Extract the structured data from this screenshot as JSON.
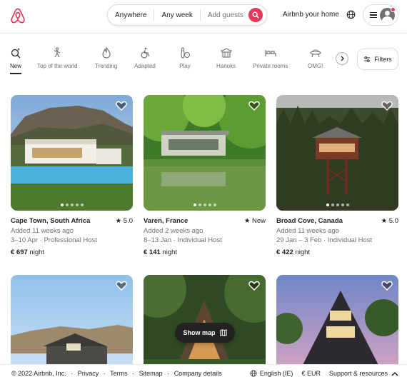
{
  "header": {
    "search": {
      "where": "Anywhere",
      "when": "Any week",
      "who": "Add guests"
    },
    "host_link": "Airbnb your home"
  },
  "categories": [
    {
      "label": "New",
      "icon": "new-sparkle-icon",
      "active": true
    },
    {
      "label": "Top of the world",
      "icon": "mountain-climber-icon"
    },
    {
      "label": "Trending",
      "icon": "flame-icon"
    },
    {
      "label": "Adapted",
      "icon": "wheelchair-icon"
    },
    {
      "label": "Play",
      "icon": "bowling-icon"
    },
    {
      "label": "Hanoks",
      "icon": "hanok-house-icon"
    },
    {
      "label": "Private rooms",
      "icon": "bed-icon"
    },
    {
      "label": "OMG!",
      "icon": "ufo-house-icon"
    }
  ],
  "filters_label": "Filters",
  "listings": [
    {
      "title": "Cape Town, South Africa",
      "rating": "5.0",
      "added": "Added 11 weeks ago",
      "dates_host": "3–10 Apr · Professional Host",
      "price": "€ 697",
      "price_unit": " night"
    },
    {
      "title": "Varen, France",
      "rating": "New",
      "added": "Added 2 weeks ago",
      "dates_host": "8–13 Jan · Individual Host",
      "price": "€ 141",
      "price_unit": " night"
    },
    {
      "title": "Broad Cove, Canada",
      "rating": "5.0",
      "added": "Added 11 weeks ago",
      "dates_host": "29 Jan – 3 Feb · Individual Host",
      "price": "€ 422",
      "price_unit": " night"
    }
  ],
  "show_map_label": "Show map",
  "footer": {
    "copyright": "© 2022 Airbnb, Inc.",
    "links": [
      "Privacy",
      "Terms",
      "Sitemap",
      "Company details"
    ],
    "sep": "·",
    "language": "English (IE)",
    "currency": "€  EUR",
    "support": "Support & resources"
  },
  "colors": {
    "brand": "#e0395b",
    "text": "#222222",
    "muted": "#717171",
    "border": "#dddddd"
  }
}
